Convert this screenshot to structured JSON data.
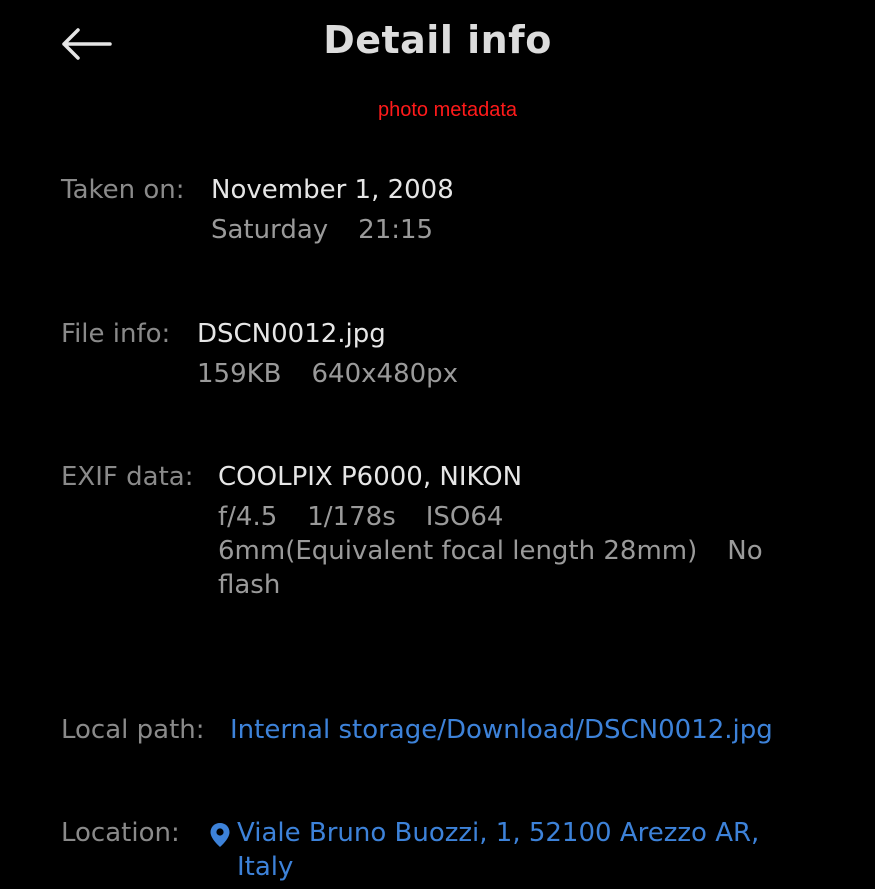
{
  "header": {
    "title": "Detail info",
    "back_icon": "arrow-left-icon"
  },
  "annotation": "photo metadata",
  "taken_on": {
    "label": "Taken on:",
    "date": "November 1, 2008",
    "weekday": "Saturday",
    "time": "21:15"
  },
  "file_info": {
    "label": "File info:",
    "name": "DSCN0012.jpg",
    "size": "159KB",
    "dimensions": "640x480px"
  },
  "exif": {
    "label": "EXIF data:",
    "camera": "COOLPIX P6000, NIKON",
    "aperture": "f/4.5",
    "shutter": "1/178s",
    "iso": "ISO64",
    "focal": "6mm(Equivalent focal length 28mm)",
    "flash": "No flash"
  },
  "local_path": {
    "label": "Local path:",
    "value": "Internal storage/Download/DSCN0012.jpg"
  },
  "location": {
    "label": "Location:",
    "icon": "location-pin-icon",
    "address": "Viale Bruno Buozzi, 1, 52100 Arezzo AR, Italy"
  },
  "colors": {
    "background": "#000000",
    "label": "#8a8a8a",
    "link": "#3d82d9",
    "annotation": "#ff1a1a"
  }
}
